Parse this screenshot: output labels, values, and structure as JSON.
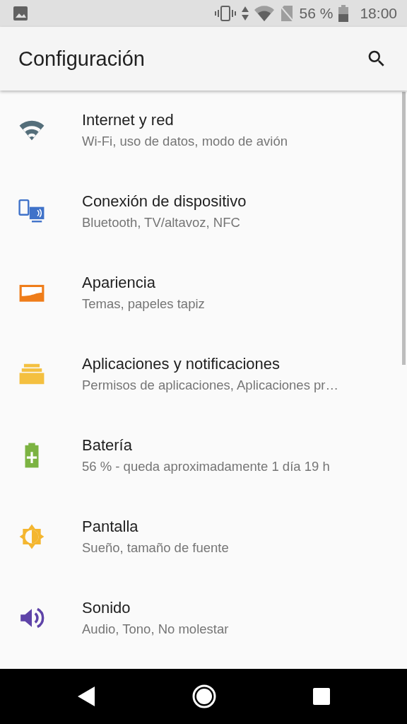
{
  "status_bar": {
    "battery_percent": "56 %",
    "time": "18:00"
  },
  "app_bar": {
    "title": "Configuración"
  },
  "settings": [
    {
      "kind": "wifi",
      "color": "#546e7a",
      "title": "Internet y red",
      "summary": "Wi-Fi, uso de datos, modo de avión"
    },
    {
      "kind": "devices",
      "color": "#3f72c9",
      "title": "Conexión de dispositivo",
      "summary": "Bluetooth, TV/altavoz, NFC"
    },
    {
      "kind": "appearance",
      "color": "#ef7d1a",
      "title": "Apariencia",
      "summary": "Temas, papeles tapiz"
    },
    {
      "kind": "apps",
      "color": "#f4c040",
      "title": "Aplicaciones y notificaciones",
      "summary": "Permisos de aplicaciones, Aplicaciones pr…"
    },
    {
      "kind": "battery",
      "color": "#7cb342",
      "title": "Batería",
      "summary": "56 % - queda aproximadamente 1 día 19 h"
    },
    {
      "kind": "display",
      "color": "#f4b630",
      "title": "Pantalla",
      "summary": "Sueño, tamaño de fuente"
    },
    {
      "kind": "sound",
      "color": "#5e43a8",
      "title": "Sonido",
      "summary": "Audio, Tono, No molestar"
    }
  ]
}
